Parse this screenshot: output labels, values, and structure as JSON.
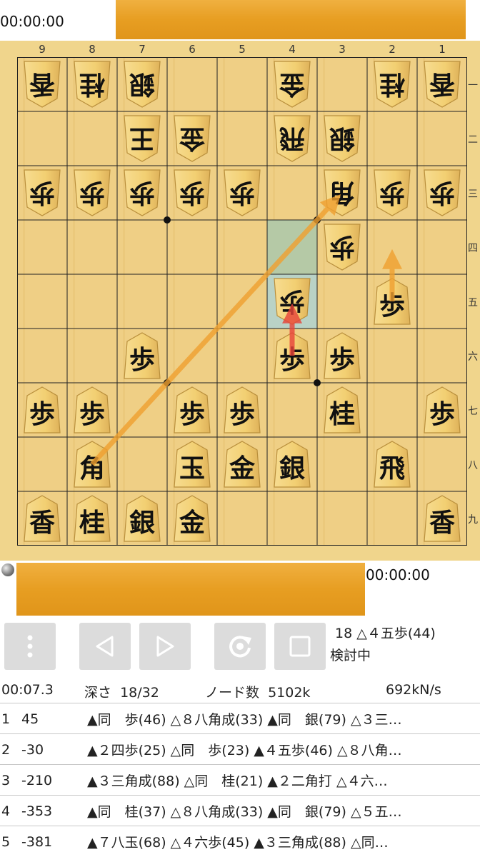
{
  "top_clock": "00:00:00",
  "bottom_clock": "00:00:00",
  "file_labels": [
    "9",
    "8",
    "7",
    "6",
    "5",
    "4",
    "3",
    "2",
    "1"
  ],
  "rank_labels": [
    "一",
    "二",
    "三",
    "四",
    "五",
    "六",
    "七",
    "八",
    "九"
  ],
  "pieces": [
    {
      "f": 9,
      "r": 1,
      "t": "香",
      "o": "gote"
    },
    {
      "f": 8,
      "r": 1,
      "t": "桂",
      "o": "gote"
    },
    {
      "f": 7,
      "r": 1,
      "t": "銀",
      "o": "gote"
    },
    {
      "f": 4,
      "r": 1,
      "t": "金",
      "o": "gote"
    },
    {
      "f": 2,
      "r": 1,
      "t": "桂",
      "o": "gote"
    },
    {
      "f": 1,
      "r": 1,
      "t": "香",
      "o": "gote"
    },
    {
      "f": 7,
      "r": 2,
      "t": "王",
      "o": "gote"
    },
    {
      "f": 6,
      "r": 2,
      "t": "金",
      "o": "gote"
    },
    {
      "f": 4,
      "r": 2,
      "t": "飛",
      "o": "gote"
    },
    {
      "f": 3,
      "r": 2,
      "t": "銀",
      "o": "gote"
    },
    {
      "f": 9,
      "r": 3,
      "t": "歩",
      "o": "gote"
    },
    {
      "f": 8,
      "r": 3,
      "t": "歩",
      "o": "gote"
    },
    {
      "f": 7,
      "r": 3,
      "t": "歩",
      "o": "gote"
    },
    {
      "f": 6,
      "r": 3,
      "t": "歩",
      "o": "gote"
    },
    {
      "f": 5,
      "r": 3,
      "t": "歩",
      "o": "gote"
    },
    {
      "f": 3,
      "r": 3,
      "t": "角",
      "o": "gote"
    },
    {
      "f": 2,
      "r": 3,
      "t": "歩",
      "o": "gote"
    },
    {
      "f": 1,
      "r": 3,
      "t": "歩",
      "o": "gote"
    },
    {
      "f": 3,
      "r": 4,
      "t": "歩",
      "o": "gote"
    },
    {
      "f": 4,
      "r": 5,
      "t": "歩",
      "o": "gote"
    },
    {
      "f": 2,
      "r": 5,
      "t": "歩",
      "o": "sente"
    },
    {
      "f": 7,
      "r": 6,
      "t": "歩",
      "o": "sente"
    },
    {
      "f": 4,
      "r": 6,
      "t": "歩",
      "o": "sente"
    },
    {
      "f": 3,
      "r": 6,
      "t": "歩",
      "o": "sente"
    },
    {
      "f": 9,
      "r": 7,
      "t": "歩",
      "o": "sente"
    },
    {
      "f": 8,
      "r": 7,
      "t": "歩",
      "o": "sente"
    },
    {
      "f": 6,
      "r": 7,
      "t": "歩",
      "o": "sente"
    },
    {
      "f": 5,
      "r": 7,
      "t": "歩",
      "o": "sente"
    },
    {
      "f": 3,
      "r": 7,
      "t": "桂",
      "o": "sente"
    },
    {
      "f": 1,
      "r": 7,
      "t": "歩",
      "o": "sente"
    },
    {
      "f": 8,
      "r": 8,
      "t": "角",
      "o": "sente"
    },
    {
      "f": 6,
      "r": 8,
      "t": "玉",
      "o": "sente"
    },
    {
      "f": 5,
      "r": 8,
      "t": "金",
      "o": "sente"
    },
    {
      "f": 4,
      "r": 8,
      "t": "銀",
      "o": "sente"
    },
    {
      "f": 2,
      "r": 8,
      "t": "飛",
      "o": "sente"
    },
    {
      "f": 9,
      "r": 9,
      "t": "香",
      "o": "sente"
    },
    {
      "f": 8,
      "r": 9,
      "t": "桂",
      "o": "sente"
    },
    {
      "f": 7,
      "r": 9,
      "t": "銀",
      "o": "sente"
    },
    {
      "f": 6,
      "r": 9,
      "t": "金",
      "o": "sente"
    },
    {
      "f": 1,
      "r": 9,
      "t": "香",
      "o": "sente"
    }
  ],
  "last_move": {
    "from": [
      4,
      4
    ],
    "to": [
      4,
      5
    ]
  },
  "arrows": [
    {
      "from": [
        8,
        8
      ],
      "to": [
        3,
        3
      ],
      "color": "#f0a030"
    },
    {
      "from": [
        2,
        5
      ],
      "to": [
        2,
        4
      ],
      "color": "#f0a030"
    },
    {
      "from": [
        4,
        6
      ],
      "to": [
        4,
        5
      ],
      "color": "#e8433a"
    }
  ],
  "star_points": [
    [
      6,
      3
    ],
    [
      3,
      3
    ],
    [
      6,
      6
    ],
    [
      3,
      6
    ]
  ],
  "status": {
    "move": "18 △４五歩(44)",
    "state": "検討中"
  },
  "engine": {
    "time": "00:07.3",
    "depth": "深さ  18/32",
    "nodes": "ノード数  5102k",
    "nps": "692kN/s"
  },
  "pv_lines": [
    {
      "num": "1",
      "score": "45",
      "pv": "▲同　歩(46) △８八角成(33) ▲同　銀(79) △３三…"
    },
    {
      "num": "2",
      "score": "-30",
      "pv": "▲２四歩(25) △同　歩(23) ▲４五歩(46) △８八角…"
    },
    {
      "num": "3",
      "score": "-210",
      "pv": "▲３三角成(88) △同　桂(21) ▲２二角打 △４六…"
    },
    {
      "num": "4",
      "score": "-353",
      "pv": "▲同　桂(37) △８八角成(33) ▲同　銀(79) △５五…"
    },
    {
      "num": "5",
      "score": "-381",
      "pv": "▲７八玉(68) △４六歩(45) ▲３三角成(88) △同…"
    }
  ]
}
